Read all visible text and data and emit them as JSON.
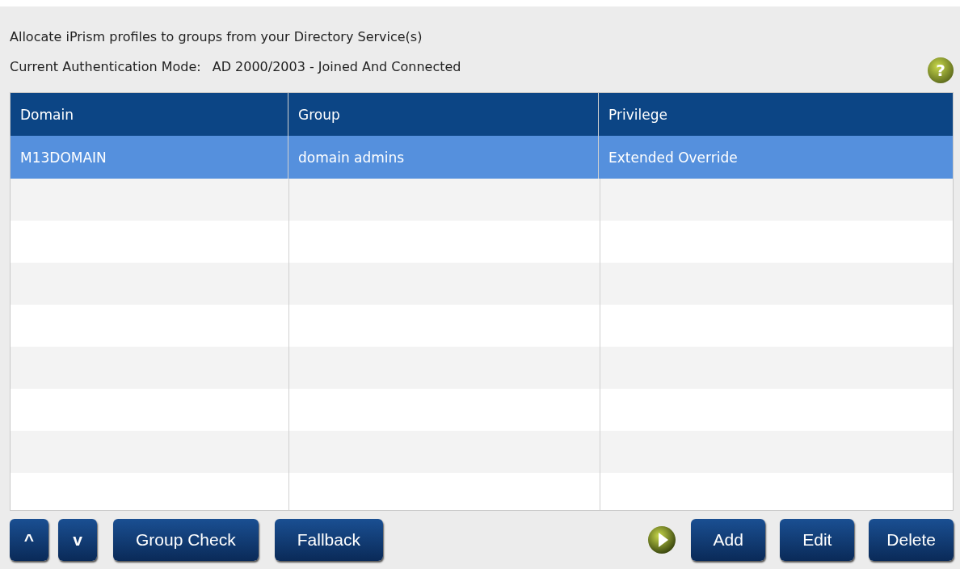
{
  "intro": "Allocate iPrism profiles to groups from your Directory Service(s)",
  "auth_mode": {
    "label": "Current Authentication Mode:",
    "value": "AD 2000/2003 - Joined And Connected"
  },
  "help": {
    "label": "?"
  },
  "table": {
    "columns": [
      "Domain",
      "Group",
      "Privilege"
    ],
    "rows": [
      {
        "cells": [
          "M13DOMAIN",
          "domain admins",
          "Extended Override"
        ],
        "selected": true
      }
    ]
  },
  "move_buttons": [
    {
      "label": "^"
    },
    {
      "label": "v"
    }
  ],
  "left_buttons": [
    "Group Check",
    "Fallback"
  ],
  "right_buttons": [
    "Add",
    "Edit",
    "Delete"
  ]
}
